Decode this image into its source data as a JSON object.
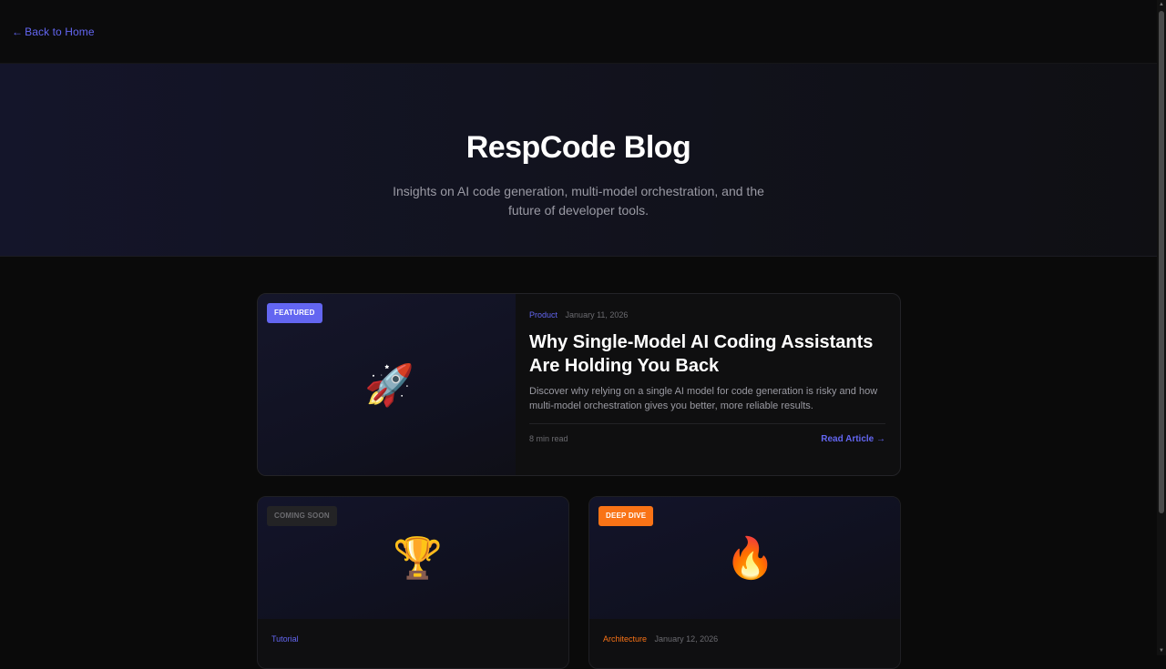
{
  "nav": {
    "back_label": "Back to Home",
    "back_arrow": "←"
  },
  "hero": {
    "title": "RespCode Blog",
    "subtitle": "Insights on AI code generation, multi-model orchestration, and the future of developer tools."
  },
  "featured": {
    "badge": "FEATURED",
    "icon": "rocket-icon",
    "emoji": "🚀",
    "category": "Product",
    "date": "January 11, 2026",
    "title": "Why Single-Model AI Coding Assistants Are Holding You Back",
    "excerpt": "Discover why relying on a single AI model for code generation is risky and how multi-model orchestration gives you better, more reliable results.",
    "read_time": "8 min read",
    "read_more": "Read Article →"
  },
  "cards": [
    {
      "badge": "COMING SOON",
      "icon": "trophy-icon",
      "emoji": "🏆",
      "category": "Tutorial",
      "date": ""
    },
    {
      "badge": "DEEP DIVE",
      "icon": "fire-icon",
      "emoji": "🔥",
      "category": "Architecture",
      "date": "January 12, 2026"
    }
  ],
  "colors": {
    "accent": "#6366f1",
    "orange": "#f97316",
    "background": "#0a0a0a"
  }
}
